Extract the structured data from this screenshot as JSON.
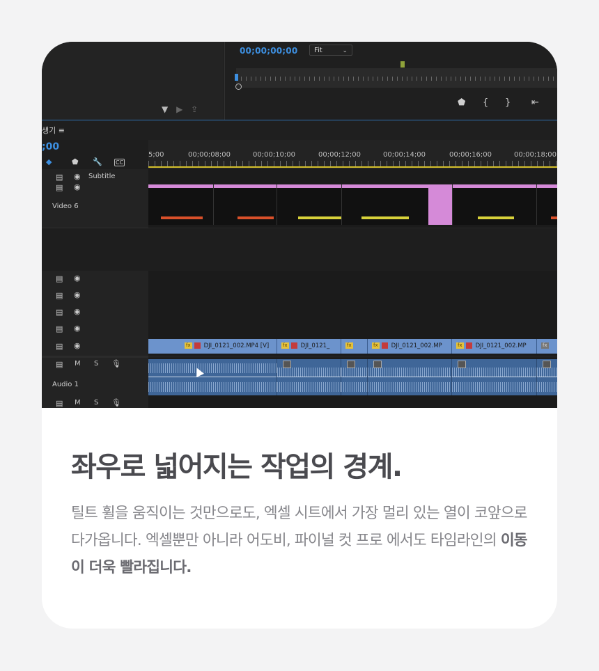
{
  "program": {
    "top_timecode": "00;00;00;00",
    "fit_label": "Fit",
    "sequence_label": "생기",
    "timeline_timecode": ";00",
    "ruler_labels": [
      "5;00",
      "00;00;08;00",
      "00;00;10;00",
      "00;00;12;00",
      "00;00;14;00",
      "00;00;16;00",
      "00;00;18;00"
    ],
    "tracks": {
      "subtitle": "Subtitle",
      "video6": "Video 6",
      "audio1": "Audio 1"
    },
    "clips": {
      "c1": "DJI_0121_002.MP4 [V]",
      "c2": "DJI_0121_",
      "c3": "DJI_0121_002.MP",
      "c4": "DJI_0121_002.MP"
    },
    "track_letters": {
      "m": "M",
      "s": "S"
    }
  },
  "headline": "좌우로 넓어지는 작업의 경계.",
  "body": {
    "normal": "틸트 휠을 움직이는 것만으로도, 엑셀 시트에서 가장 멀리 있는 열이 코앞으로 다가옵니다. 엑셀뿐만 아니라 어도비, 파이널 컷 프로 에서도 타임라인의 ",
    "emphasis": "이동이 더욱 빨라집니다."
  },
  "colors": {
    "page_bg": "#f3f3f4",
    "card_bg": "#ffffff",
    "timecode_blue": "#3d8fe0",
    "clip_blue": "#6c93cc",
    "pink": "#d58ad8",
    "headline": "#4a4a4f",
    "body_text": "#86868b"
  }
}
